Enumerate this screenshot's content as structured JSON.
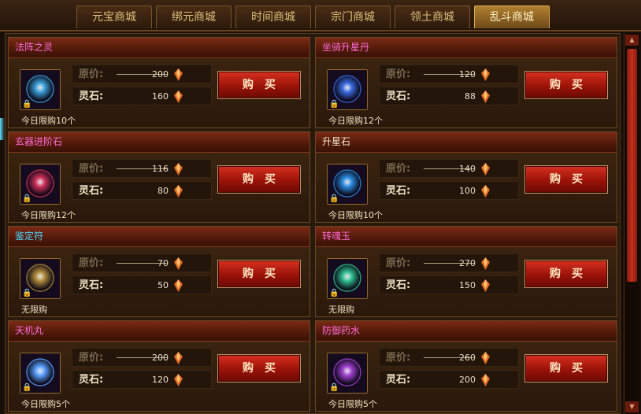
{
  "tabs": [
    {
      "label": "元宝商城",
      "active": false
    },
    {
      "label": "绑元商城",
      "active": false
    },
    {
      "label": "时间商城",
      "active": false
    },
    {
      "label": "宗门商城",
      "active": false
    },
    {
      "label": "领土商城",
      "active": false
    },
    {
      "label": "乱斗商城",
      "active": true
    }
  ],
  "labels": {
    "original_price": "原价:",
    "stone_price": "灵石:",
    "buy": "购买"
  },
  "items": [
    {
      "name": "法阵之灵",
      "name_color": "#ff6ad8",
      "original": "200",
      "stone": "160",
      "limit": "今日限购10个",
      "icon": "formation-spirit-icon",
      "accent": "#3aa0d8"
    },
    {
      "name": "坐骑升星丹",
      "name_color": "#ff6ad8",
      "original": "120",
      "stone": "88",
      "limit": "今日限购12个",
      "icon": "mount-star-pill-icon",
      "accent": "#3a6ae0"
    },
    {
      "name": "玄器进阶石",
      "name_color": "#ff6ad8",
      "original": "116",
      "stone": "80",
      "limit": "今日限购12个",
      "icon": "artifact-advance-stone-icon",
      "accent": "#d0305a"
    },
    {
      "name": "升星石",
      "name_color": "#f0e6c8",
      "original": "140",
      "stone": "100",
      "limit": "今日限购10个",
      "icon": "star-stone-icon",
      "accent": "#2a8ae0"
    },
    {
      "name": "鉴定符",
      "name_color": "#4ad8ff",
      "original": "70",
      "stone": "50",
      "limit": "无限购",
      "icon": "appraisal-talisman-icon",
      "accent": "#b08a3a"
    },
    {
      "name": "转魂玉",
      "name_color": "#ff6ad8",
      "original": "270",
      "stone": "150",
      "limit": "无限购",
      "icon": "soul-jade-icon",
      "accent": "#30c090"
    },
    {
      "name": "天机丸",
      "name_color": "#ff6ad8",
      "original": "200",
      "stone": "120",
      "limit": "今日限购5个",
      "icon": "heaven-pill-icon",
      "accent": "#5aa0ff"
    },
    {
      "name": "防御药水",
      "name_color": "#ff6ad8",
      "original": "260",
      "stone": "200",
      "limit": "今日限购5个",
      "icon": "defense-potion-icon",
      "accent": "#a040d0"
    }
  ]
}
